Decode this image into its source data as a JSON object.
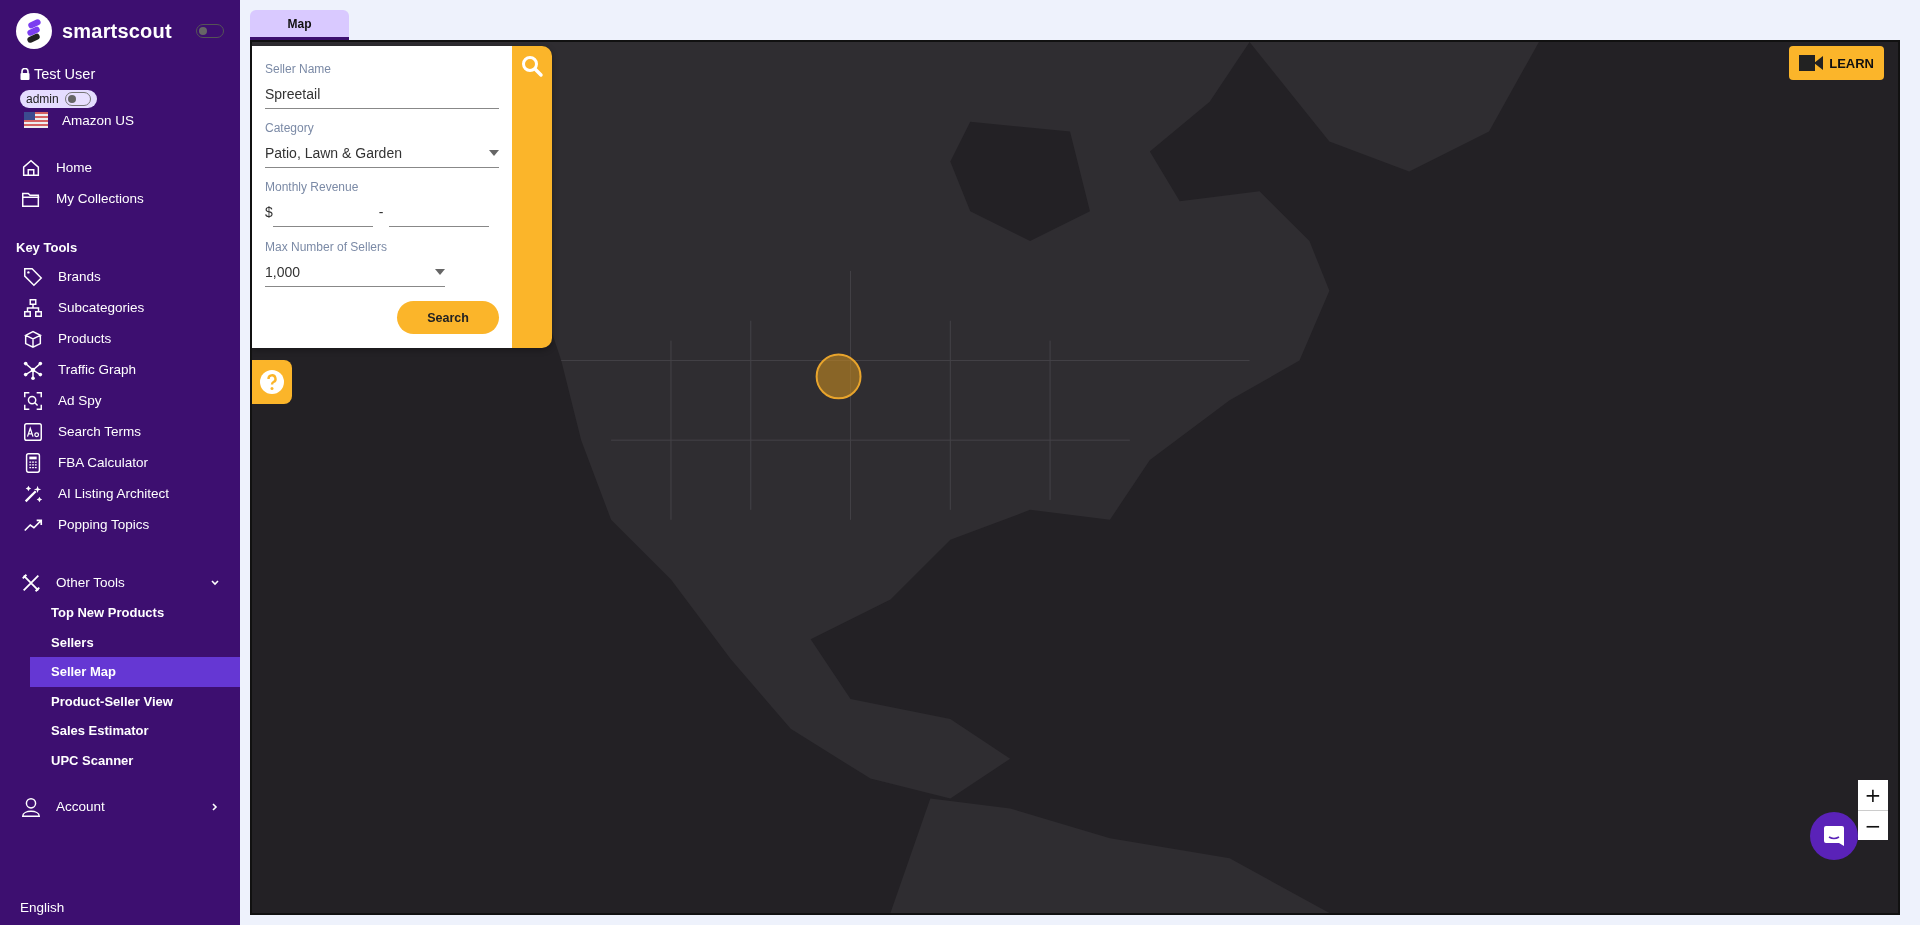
{
  "brand": {
    "name": "smartscout",
    "theme_switch_on": false
  },
  "user": {
    "name": "Test User",
    "role": "admin",
    "role_switch_on": false,
    "marketplace": "Amazon US"
  },
  "nav": [
    {
      "label": "Home"
    },
    {
      "label": "My Collections"
    }
  ],
  "key_tools": {
    "title": "Key Tools",
    "items": [
      {
        "label": "Brands"
      },
      {
        "label": "Subcategories"
      },
      {
        "label": "Products"
      },
      {
        "label": "Traffic Graph"
      },
      {
        "label": "Ad Spy"
      },
      {
        "label": "Search Terms"
      },
      {
        "label": "FBA Calculator"
      },
      {
        "label": "AI Listing Architect"
      },
      {
        "label": "Popping Topics"
      }
    ]
  },
  "other_tools": {
    "label": "Other Tools",
    "expanded": true,
    "items": [
      {
        "label": "Top New Products",
        "selected": false
      },
      {
        "label": "Sellers",
        "selected": false
      },
      {
        "label": "Seller Map",
        "selected": true
      },
      {
        "label": "Product-Seller View",
        "selected": false
      },
      {
        "label": "Sales Estimator",
        "selected": false
      },
      {
        "label": "UPC Scanner",
        "selected": false
      }
    ]
  },
  "account": {
    "label": "Account",
    "expanded": false
  },
  "language": "English",
  "tabs": [
    {
      "label": "Map",
      "selected": true
    }
  ],
  "seller_search": {
    "fields": [
      {
        "kind": "text",
        "label": "Seller Name",
        "value": "Spreetail"
      },
      {
        "kind": "select",
        "label": "Category",
        "value": "Patio, Lawn & Garden"
      },
      {
        "kind": "range",
        "label": "Monthly Revenue",
        "prefix": "$",
        "separator": "-"
      },
      {
        "kind": "select",
        "label": "Max Number of Sellers",
        "value": "1,000"
      }
    ],
    "button": "Search"
  },
  "map": {
    "learn_button": "LEARN",
    "zoom_in": "+",
    "zoom_out": "−"
  }
}
